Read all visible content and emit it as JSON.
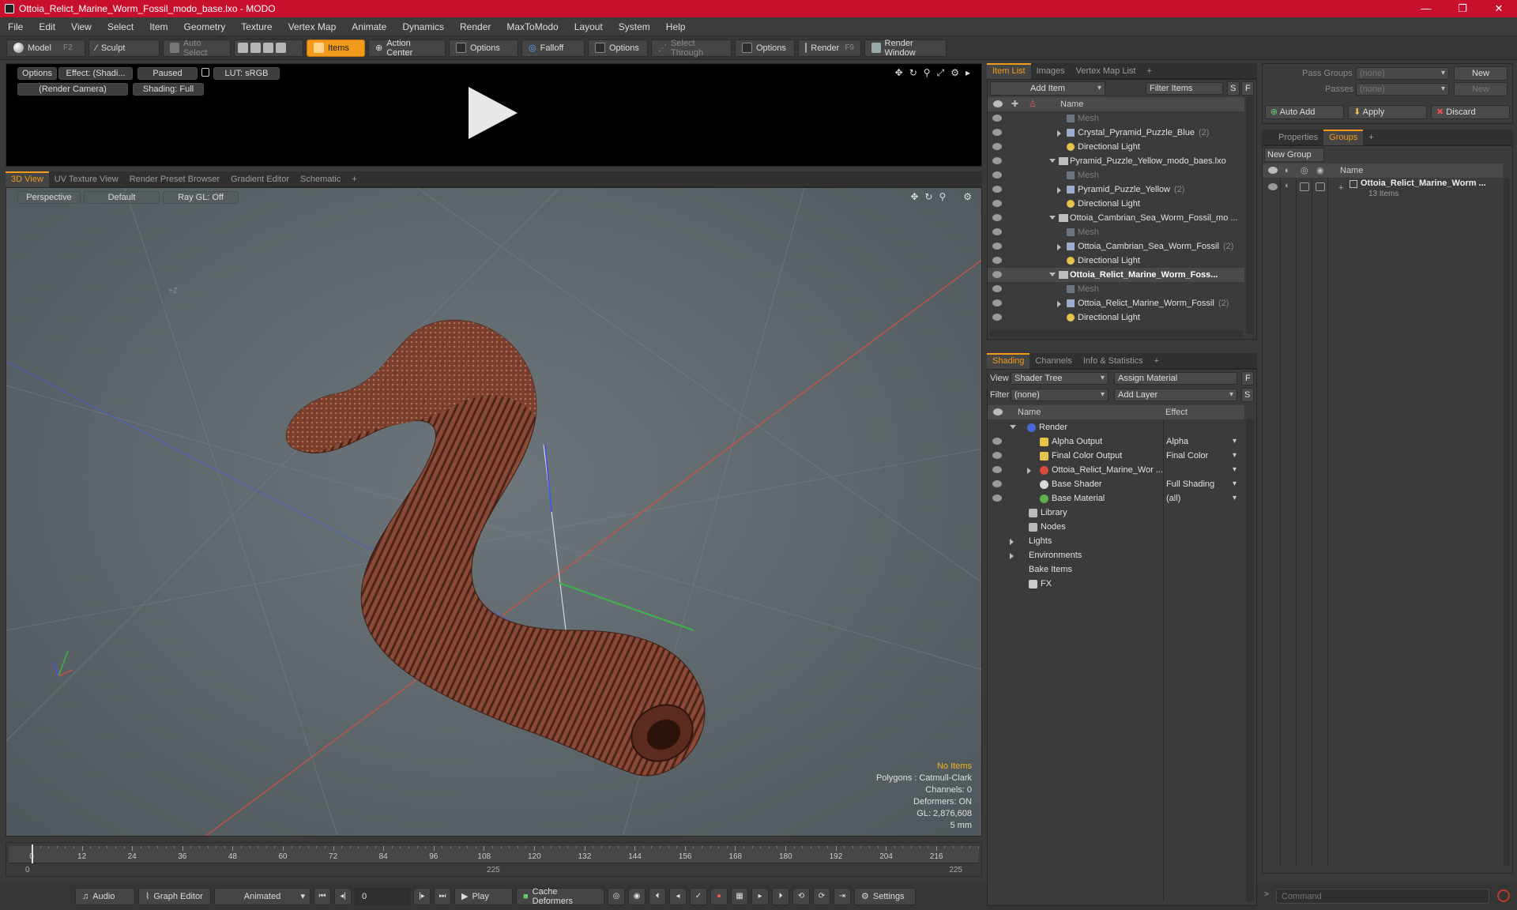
{
  "window": {
    "title": "Ottoia_Relict_Marine_Worm_Fossil_modo_base.lxo - MODO",
    "controls": [
      "—",
      "❐",
      "✕"
    ]
  },
  "menu": [
    "File",
    "Edit",
    "View",
    "Select",
    "Item",
    "Geometry",
    "Texture",
    "Vertex Map",
    "Animate",
    "Dynamics",
    "Render",
    "MaxToModo",
    "Layout",
    "System",
    "Help"
  ],
  "toolbar": {
    "model": "Model",
    "model_key": "F2",
    "sculpt": "Sculpt",
    "auto_select": "Auto Select",
    "items": "Items",
    "action_center": "Action Center",
    "options1": "Options",
    "falloff": "Falloff",
    "options2": "Options",
    "select_through": "Select Through",
    "options3": "Options",
    "render": "Render",
    "render_key": "F9",
    "render_window": "Render Window"
  },
  "preview": {
    "options": "Options",
    "effect": "Effect: (Shadi...",
    "paused": "Paused",
    "lut": "LUT: sRGB",
    "camera": "(Render Camera)",
    "shading": "Shading: Full"
  },
  "viewport_tabs": [
    "3D View",
    "UV Texture View",
    "Render Preset Browser",
    "Gradient Editor",
    "Schematic",
    "+"
  ],
  "viewport": {
    "perspective": "Perspective",
    "default": "Default",
    "raygl": "Ray GL: Off",
    "axis_label": "+Z",
    "stats": {
      "no_items": "No Items",
      "polygons": "Polygons : Catmull-Clark",
      "channels": "Channels: 0",
      "deformers": "Deformers: ON",
      "gl": "GL: 2,876,608",
      "unit": "5 mm"
    }
  },
  "timeline": {
    "ticks": [
      "0",
      "12",
      "24",
      "36",
      "48",
      "60",
      "72",
      "84",
      "96",
      "108",
      "120",
      "132",
      "144",
      "156",
      "168",
      "180",
      "192",
      "204",
      "216"
    ],
    "start": "0",
    "mid": "225",
    "end": "225"
  },
  "transport": {
    "audio": "Audio",
    "graph_editor": "Graph Editor",
    "animated": "Animated",
    "frame": "0",
    "play": "Play",
    "cache_deformers": "Cache Deformers",
    "settings": "Settings"
  },
  "item_list": {
    "tabs": [
      "Item List",
      "Images",
      "Vertex Map List",
      "+"
    ],
    "add_item": "Add Item",
    "filter_items": "Filter Items",
    "s": "S",
    "f": "F",
    "name_col": "Name",
    "rows": [
      {
        "label": "Mesh",
        "kind": "mesh",
        "indent": 2,
        "dim": true,
        "count": ""
      },
      {
        "label": "Crystal_Pyramid_Puzzle_Blue",
        "kind": "mesh",
        "indent": 2,
        "dim": false,
        "count": "(2)"
      },
      {
        "label": "Directional Light",
        "kind": "light",
        "indent": 2,
        "dim": false,
        "count": ""
      },
      {
        "label": "Pyramid_Puzzle_Yellow_modo_baes.lxo",
        "kind": "scene",
        "indent": 1,
        "dim": false,
        "count": ""
      },
      {
        "label": "Mesh",
        "kind": "mesh",
        "indent": 2,
        "dim": true,
        "count": ""
      },
      {
        "label": "Pyramid_Puzzle_Yellow",
        "kind": "mesh",
        "indent": 2,
        "dim": false,
        "count": "(2)"
      },
      {
        "label": "Directional Light",
        "kind": "light",
        "indent": 2,
        "dim": false,
        "count": ""
      },
      {
        "label": "Ottoia_Cambrian_Sea_Worm_Fossil_mo ...",
        "kind": "scene",
        "indent": 1,
        "dim": false,
        "count": ""
      },
      {
        "label": "Mesh",
        "kind": "mesh",
        "indent": 2,
        "dim": true,
        "count": ""
      },
      {
        "label": "Ottoia_Cambrian_Sea_Worm_Fossil",
        "kind": "mesh",
        "indent": 2,
        "dim": false,
        "count": "(2)"
      },
      {
        "label": "Directional Light",
        "kind": "light",
        "indent": 2,
        "dim": false,
        "count": ""
      },
      {
        "label": "Ottoia_Relict_Marine_Worm_Foss...",
        "kind": "scene",
        "indent": 1,
        "dim": false,
        "count": "",
        "bold": true
      },
      {
        "label": "Mesh",
        "kind": "mesh",
        "indent": 2,
        "dim": true,
        "count": ""
      },
      {
        "label": "Ottoia_Relict_Marine_Worm_Fossil",
        "kind": "mesh",
        "indent": 2,
        "dim": false,
        "count": "(2)"
      },
      {
        "label": "Directional Light",
        "kind": "light",
        "indent": 2,
        "dim": false,
        "count": ""
      }
    ]
  },
  "shading": {
    "tabs": [
      "Shading",
      "Channels",
      "Info & Statistics",
      "+"
    ],
    "view_label": "View",
    "view_value": "Shader Tree",
    "assign_material": "Assign Material",
    "filter_label": "Filter",
    "filter_value": "(none)",
    "add_layer": "Add Layer",
    "name_col": "Name",
    "effect_col": "Effect",
    "rows": [
      {
        "label": "Render",
        "effect": ""
      },
      {
        "label": "Alpha Output",
        "effect": "Alpha"
      },
      {
        "label": "Final Color Output",
        "effect": "Final Color"
      },
      {
        "label": "Ottoia_Relict_Marine_Wor ...",
        "effect": ""
      },
      {
        "label": "Base Shader",
        "effect": "Full Shading"
      },
      {
        "label": "Base Material",
        "effect": "(all)"
      },
      {
        "label": "Library",
        "effect": ""
      },
      {
        "label": "Nodes",
        "effect": ""
      },
      {
        "label": "Lights",
        "effect": ""
      },
      {
        "label": "Environments",
        "effect": ""
      },
      {
        "label": "Bake Items",
        "effect": ""
      },
      {
        "label": "FX",
        "effect": ""
      }
    ]
  },
  "groups": {
    "pass_groups": "Pass Groups",
    "pass_groups_value": "(none)",
    "new": "New",
    "passes": "Passes",
    "passes_value": "(none)",
    "new2": "New",
    "auto_add": "Auto Add",
    "apply": "Apply",
    "discard": "Discard",
    "tabs": [
      "Properties",
      "Groups",
      "+"
    ],
    "new_group": "New Group",
    "name_col": "Name",
    "group_name": "Ottoia_Relict_Marine_Worm ...",
    "group_count": "13 Items"
  },
  "command": {
    "placeholder": "Command"
  }
}
